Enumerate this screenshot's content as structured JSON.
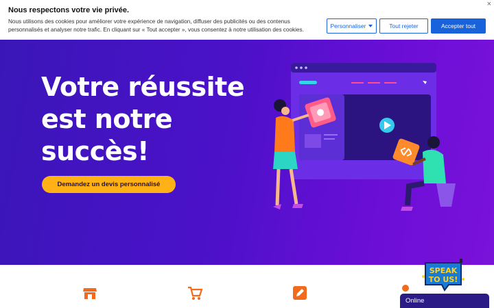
{
  "cookie": {
    "title": "Nous respectons votre vie privée.",
    "text": "Nous utilisons des cookies pour améliorer votre expérience de navigation, diffuser des publicités ou des contenus personnalisés et analyser notre trafic. En cliquant sur « Tout accepter », vous consentez à notre utilisation des cookies.",
    "close": "×",
    "customize_label": "Personnaliser",
    "reject_label": "Tout rejeter",
    "accept_label": "Accepter tout"
  },
  "hero": {
    "title": "Votre réussite est notre succès!",
    "cta_label": "Demandez un devis personnalisé"
  },
  "badges": {
    "speak_line1": "SPEAK",
    "speak_line2": "TO US!"
  },
  "chat": {
    "status": "Online"
  },
  "colors": {
    "accent": "#1863dc",
    "cta": "#ffb116",
    "icon_orange": "#f26b1d",
    "chat": "#2a1b86"
  },
  "features": {
    "icons": [
      "store-icon",
      "shopping-cart-icon",
      "edit-icon",
      "person-icon"
    ]
  }
}
